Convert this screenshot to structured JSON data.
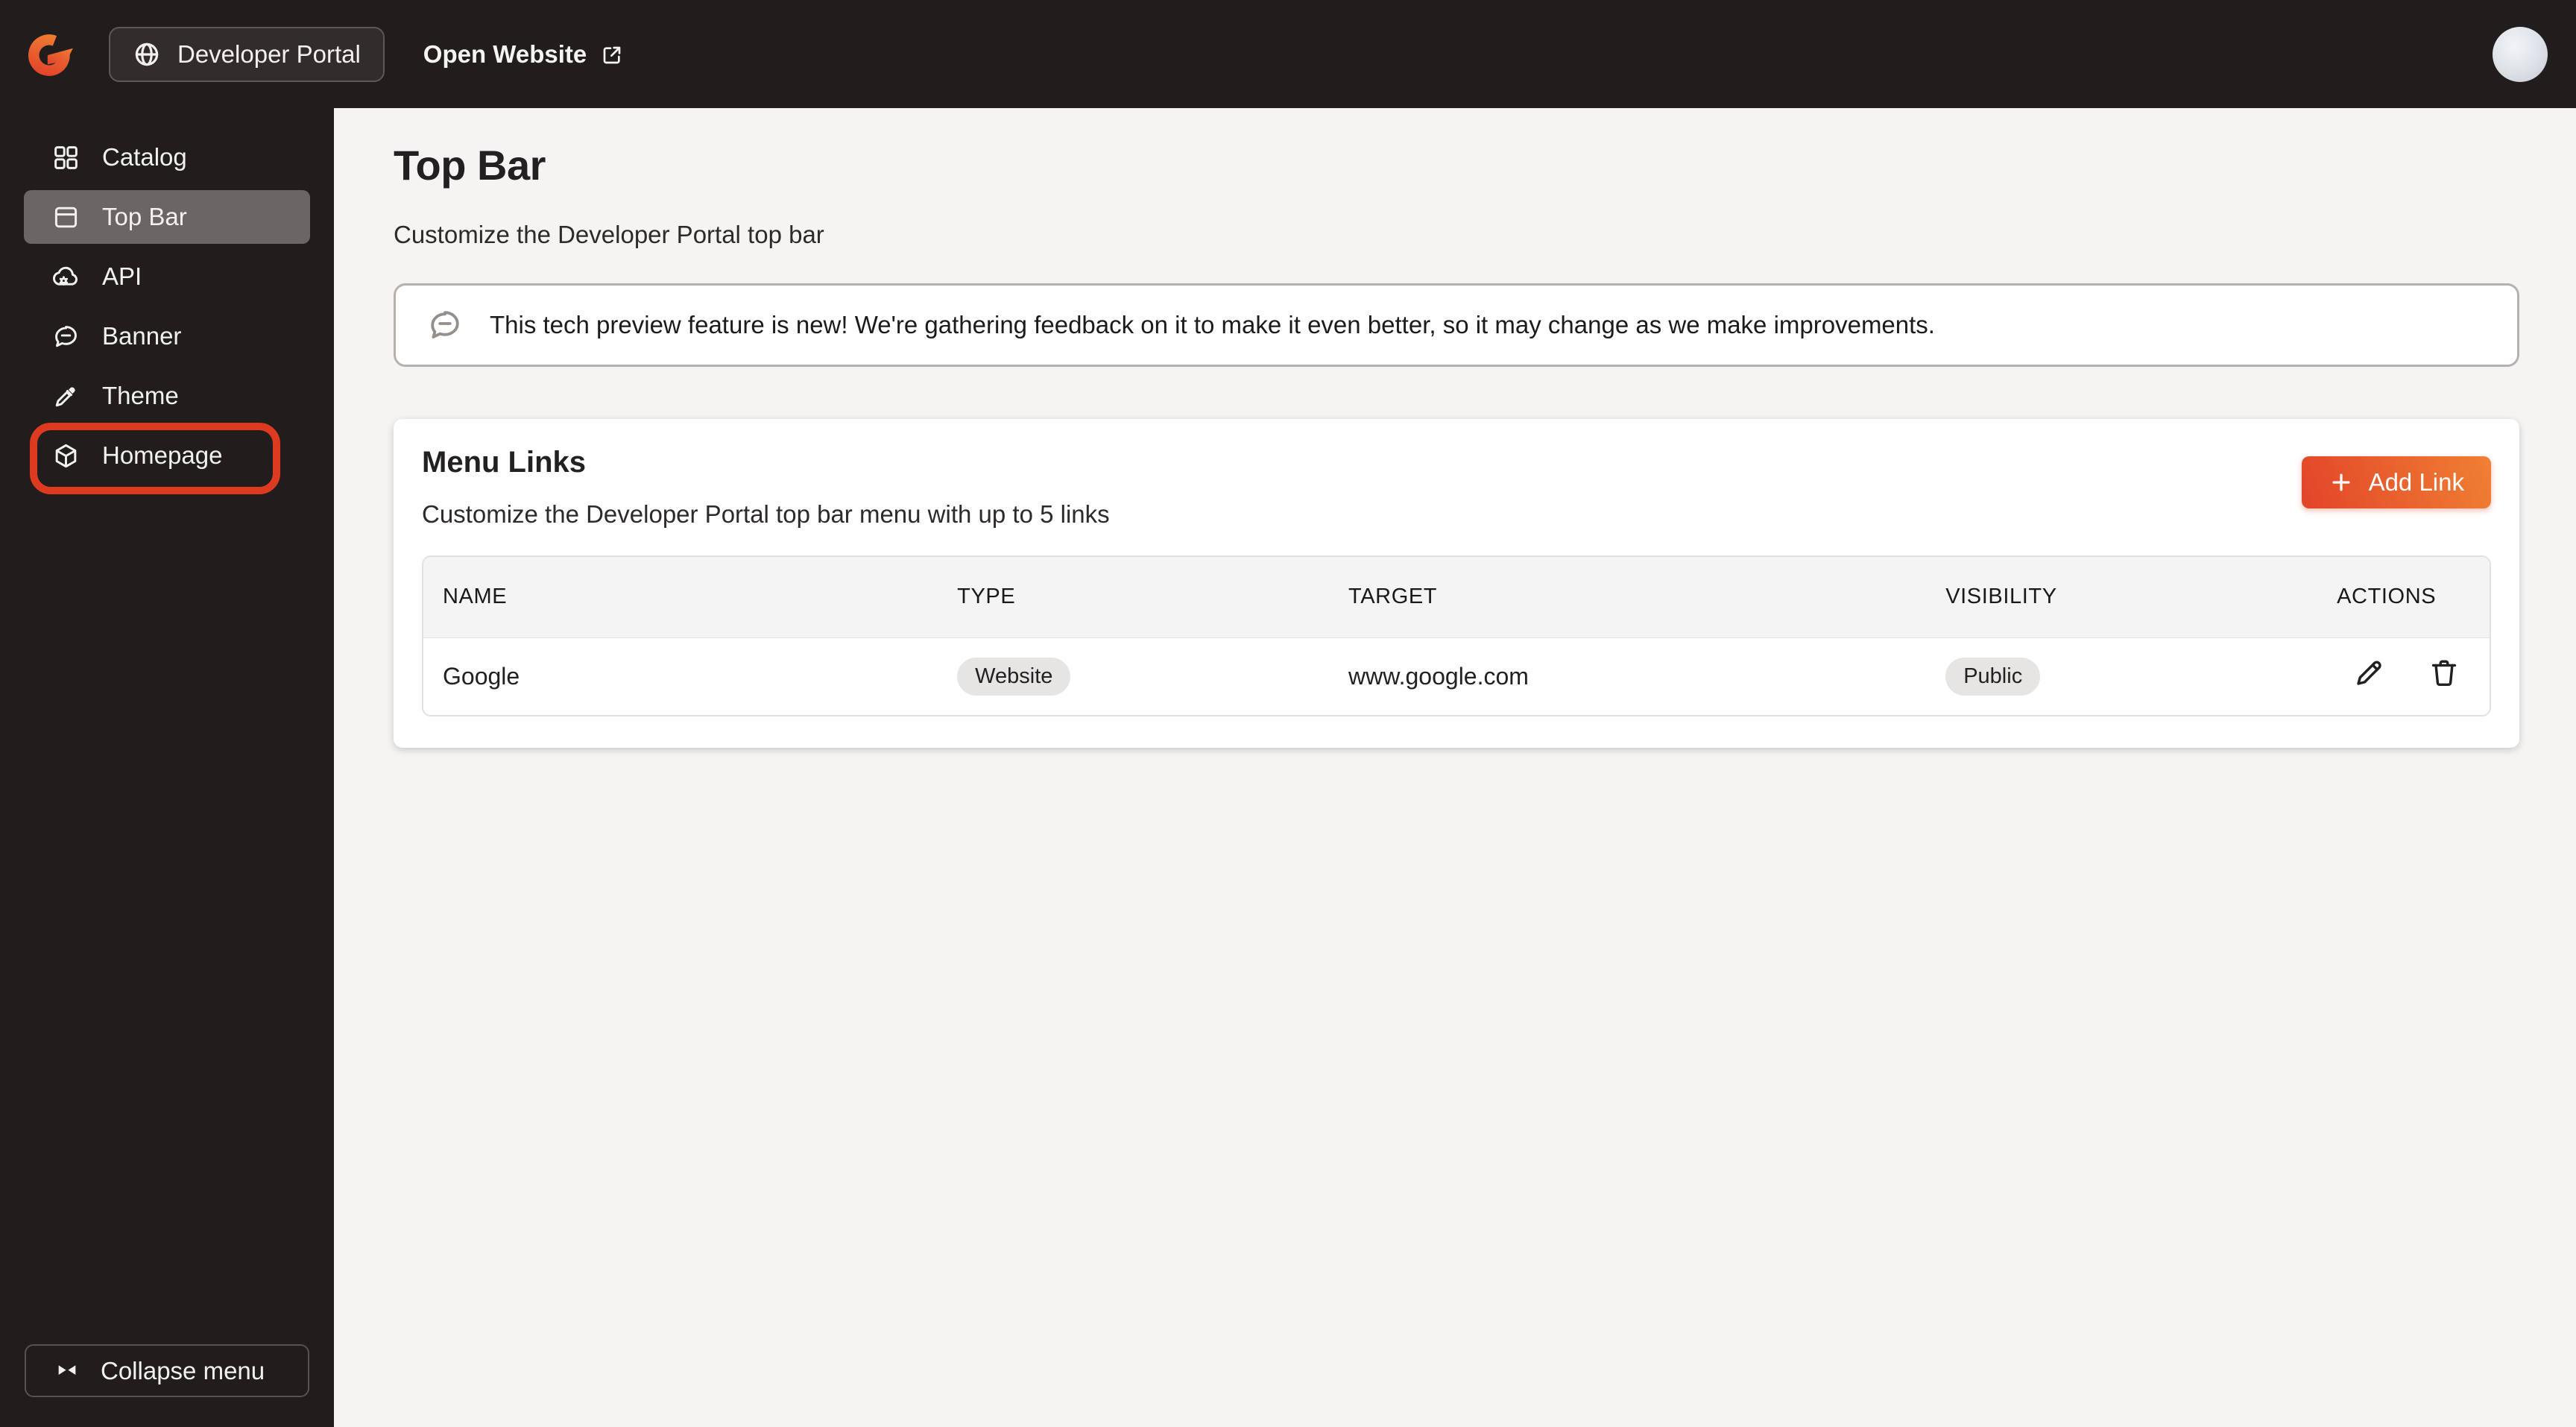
{
  "header": {
    "product_button": "Developer Portal",
    "open_website": "Open Website"
  },
  "sidebar": {
    "items": [
      {
        "label": "Catalog",
        "icon": "grid-icon"
      },
      {
        "label": "Top Bar",
        "icon": "window-top-bar-icon"
      },
      {
        "label": "API",
        "icon": "cloud-gear-icon"
      },
      {
        "label": "Banner",
        "icon": "message-bubble-icon"
      },
      {
        "label": "Theme",
        "icon": "eyedropper-icon"
      },
      {
        "label": "Homepage",
        "icon": "cube-icon"
      }
    ],
    "collapse_button": "Collapse menu"
  },
  "page": {
    "title": "Top Bar",
    "subtitle": "Customize the Developer Portal top bar",
    "tech_preview_notice": "This tech preview feature is new! We're gathering feedback on it to make it even better, so it may change as we make improvements."
  },
  "menu_links": {
    "title": "Menu Links",
    "subtitle": "Customize the Developer Portal top bar menu with up to 5 links",
    "add_link_button": "Add Link",
    "table": {
      "columns": [
        "NAME",
        "TYPE",
        "TARGET",
        "VISIBILITY",
        "ACTIONS"
      ],
      "rows": [
        {
          "name": "Google",
          "type": "Website",
          "target": "www.google.com",
          "visibility": "Public"
        }
      ]
    }
  },
  "colors": {
    "sidebar_background": "#221d1d",
    "selected_item_background": "#6b6665",
    "annotation_border": "#de3a20",
    "accent_gradient_start": "#e24429",
    "accent_gradient_end": "#f08033"
  }
}
